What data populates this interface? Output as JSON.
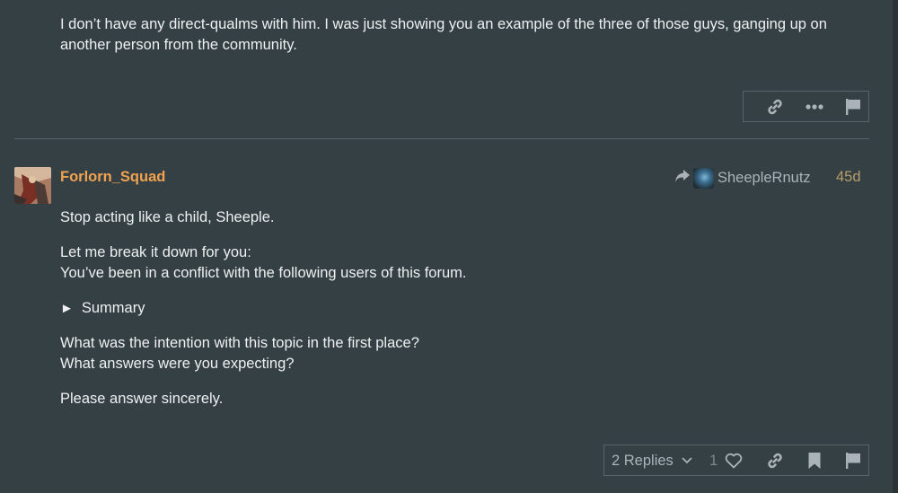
{
  "previous_post": {
    "text": "I don’t have any direct-qualms with him. I was just showing you an example of the three of those guys, ganging up on another person from the community.",
    "actions": {
      "link_icon": "link-icon",
      "more_icon": "ellipsis-icon",
      "flag_icon": "flag-icon"
    }
  },
  "post": {
    "username": "Forlorn_Squad",
    "reply_to_user": "SheepleRnutz",
    "date": "45d",
    "lines": [
      "Stop acting like a child, Sheeple.",
      "Let me break it down for you:",
      "You’ve been in a conflict with the following users of this forum.",
      "What was the intention with this topic in the first place?",
      "What answers were you expecting?",
      "Please answer sincerely."
    ],
    "summary_label": "Summary",
    "summary_marker": "►",
    "replies_label": "2 Replies",
    "like_count": "1",
    "actions": {
      "like_icon": "heart-icon",
      "link_icon": "link-icon",
      "bookmark_icon": "bookmark-icon",
      "flag_icon": "flag-icon",
      "reply_icon": "share-arrow-icon"
    }
  },
  "colors": {
    "background": "#354045",
    "username": "#f0a24f",
    "date": "#b99c6a",
    "muted": "#a9b3b8",
    "border": "#56636a"
  }
}
